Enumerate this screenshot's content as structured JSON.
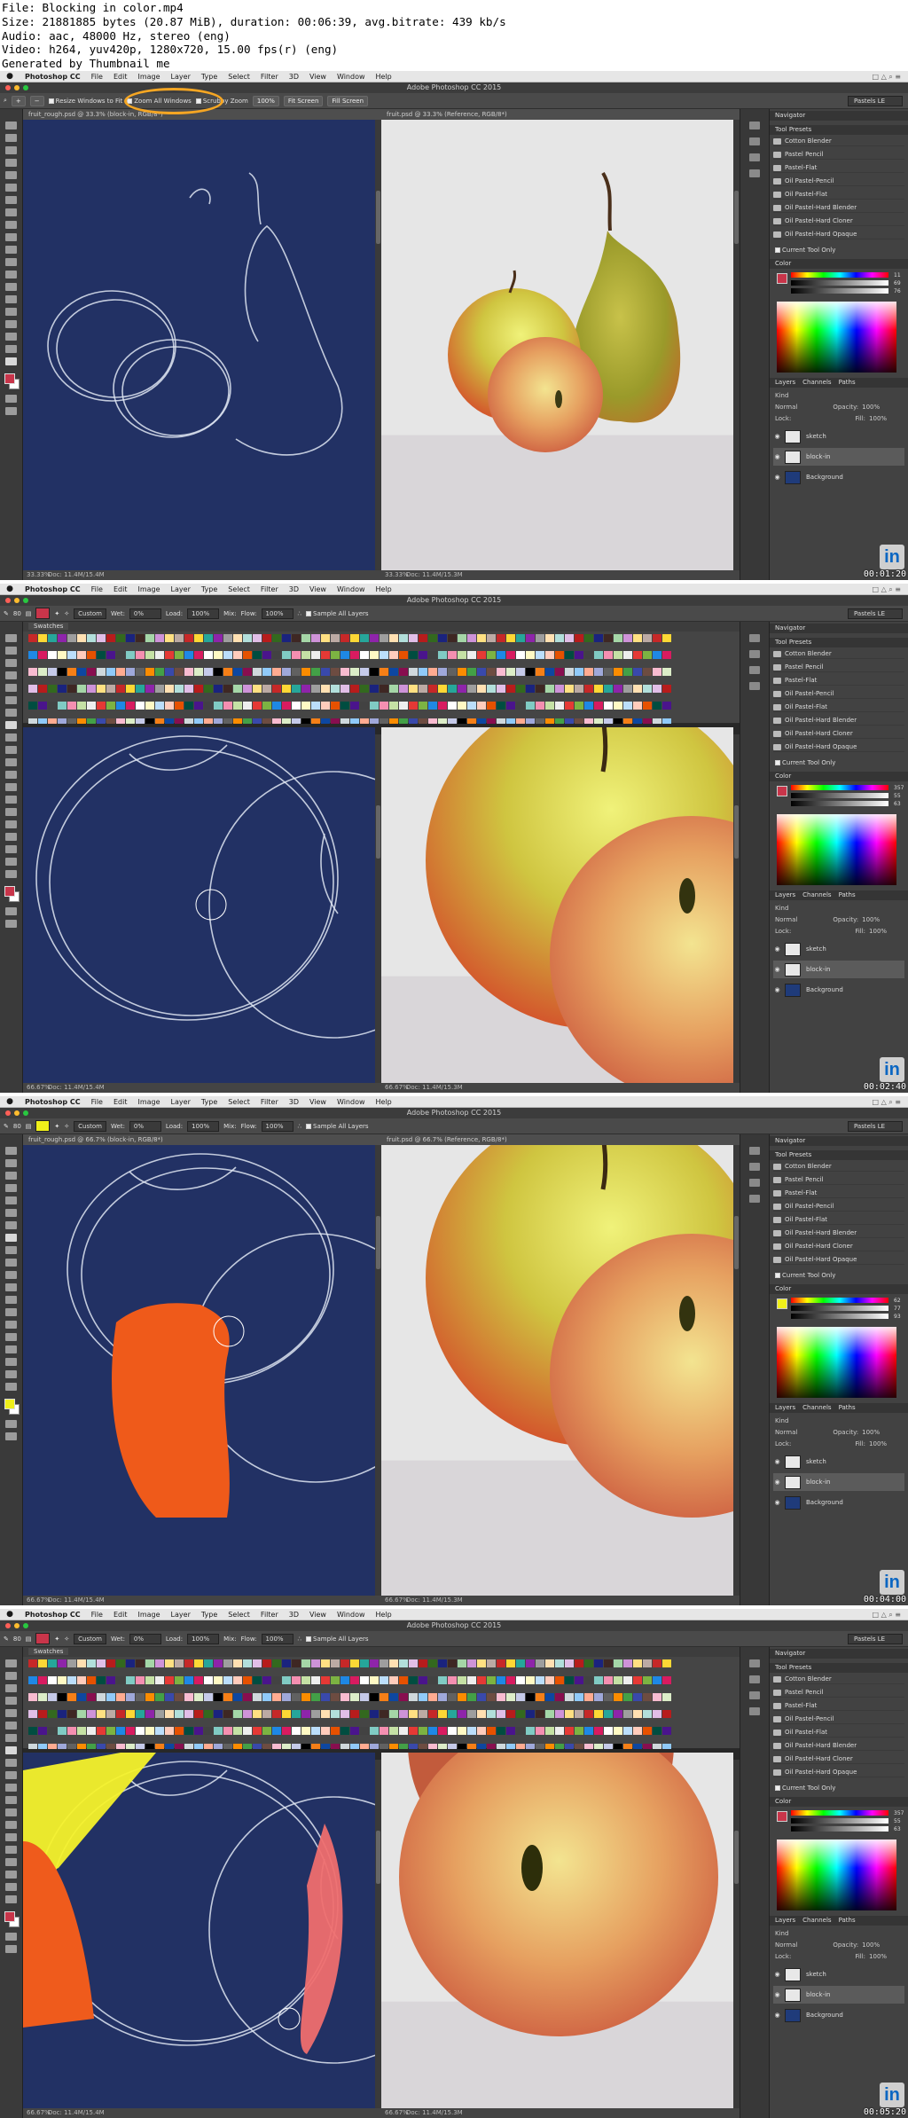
{
  "header": {
    "lines": [
      "File: Blocking in color.mp4",
      "Size: 21881885 bytes (20.87 MiB), duration: 00:06:39, avg.bitrate: 439 kb/s",
      "Audio: aac, 48000 Hz, stereo (eng)",
      "Video: h264, yuv420p, 1280x720, 15.00 fps(r) (eng)",
      "Generated by Thumbnail me"
    ]
  },
  "app": {
    "menu": [
      "Photoshop CC",
      "File",
      "Edit",
      "Image",
      "Layer",
      "Type",
      "Select",
      "Filter",
      "3D",
      "View",
      "Window",
      "Help"
    ],
    "window_title": "Adobe Photoshop CC 2015",
    "workspace": "Pastels LE",
    "accent_orange": "#f5a623"
  },
  "zoom_options": {
    "resize": "Resize Windows to Fit",
    "zoom_all": "Zoom All Windows",
    "scrubby": "Scrubby Zoom",
    "pct": "100%",
    "fit": "Fit Screen",
    "fill": "Fill Screen"
  },
  "brush_options": {
    "size": "80",
    "custom": "Custom",
    "wet": "Wet:",
    "wet_val": "0%",
    "load": "Load:",
    "load_val": "100%",
    "mix": "Mix:",
    "flow": "Flow:",
    "flow_val": "100%",
    "sample": "Sample All Layers"
  },
  "swatches_tab": "Swatches",
  "panels": {
    "navigator": "Navigator",
    "tool_presets": "Tool Presets",
    "presets": [
      "Cotton Blender",
      "Pastel Pencil",
      "Pastel-Flat",
      "Oil Pastel-Pencil",
      "Oil Pastel-Flat",
      "Oil Pastel-Hard Blender",
      "Oil Pastel-Hard Cloner",
      "Oil Pastel-Hard Opaque"
    ],
    "current_tool_only": "Current Tool Only",
    "color": "Color",
    "layers_tabs": [
      "Layers",
      "Channels",
      "Paths"
    ],
    "kind": "Kind",
    "normal": "Normal",
    "opacity": "Opacity:",
    "opacity_val": "100%",
    "lock": "Lock:",
    "fill": "Fill:",
    "fill_val": "100%",
    "layers": [
      "sketch",
      "block-in",
      "Background"
    ]
  },
  "frames": [
    {
      "timestamp": "00:01:20",
      "tab1": "fruit_rough.psd @ 33.3% (block-in, RGB/8*)",
      "tab2": "fruit.psd @ 33.3% (Reference, RGB/8*)",
      "zoom1": "33.33%",
      "zoom2": "33.33%",
      "doc1": "Doc: 11.4M/15.4M",
      "doc2": "Doc: 11.4M/15.3M",
      "color_values": [
        "11",
        "69",
        "76"
      ],
      "fg": "#c8354a"
    },
    {
      "timestamp": "00:02:40",
      "tab1": "",
      "tab2": "",
      "zoom1": "66.67%",
      "zoom2": "66.67%",
      "doc1": "Doc: 11.4M/15.4M",
      "doc2": "Doc: 11.4M/15.3M",
      "color_values": [
        "357",
        "55",
        "63"
      ],
      "fg": "#c8354a"
    },
    {
      "timestamp": "00:04:00",
      "tab1": "fruit_rough.psd @ 66.7% (block-in, RGB/8*)",
      "tab2": "fruit.psd @ 66.7% (Reference, RGB/8*)",
      "zoom1": "66.67%",
      "zoom2": "66.67%",
      "doc1": "Doc: 11.4M/15.4M",
      "doc2": "Doc: 11.4M/15.3M",
      "color_values": [
        "62",
        "77",
        "93"
      ],
      "fg": "#f0f01a"
    },
    {
      "timestamp": "00:05:20",
      "tab1": "",
      "tab2": "",
      "zoom1": "66.67%",
      "zoom2": "66.67%",
      "doc1": "Doc: 11.4M/15.4M",
      "doc2": "Doc: 11.4M/15.3M",
      "color_values": [
        "357",
        "55",
        "63"
      ],
      "fg": "#c8354a"
    }
  ]
}
